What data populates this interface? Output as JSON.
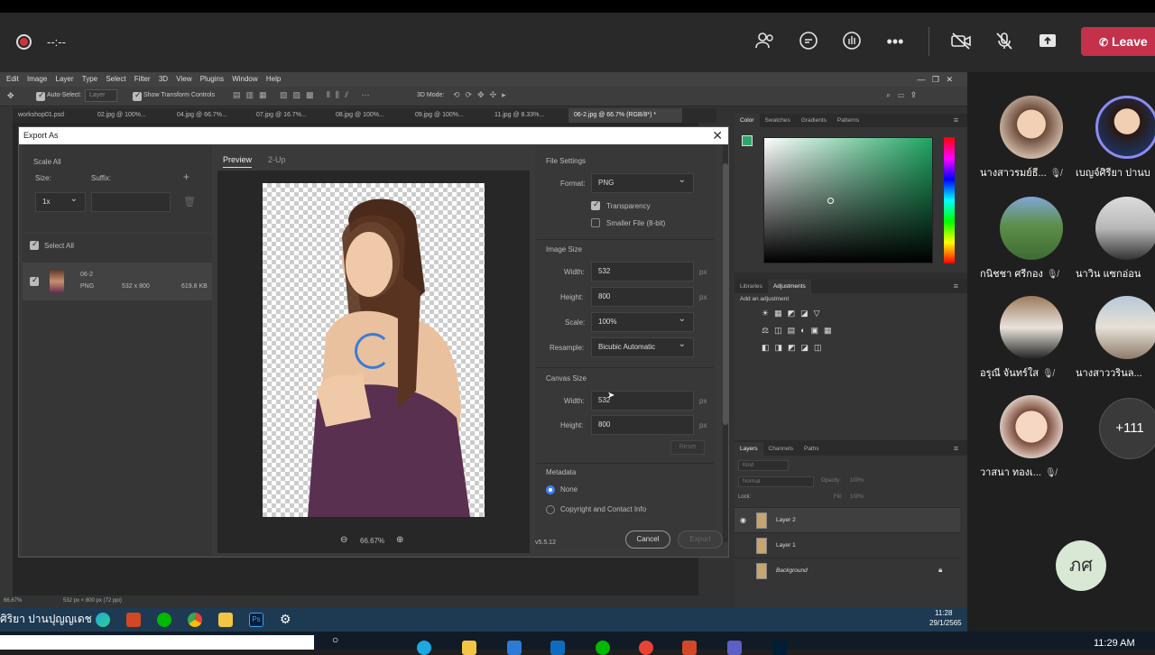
{
  "meeting": {
    "timer": "--:--",
    "leave_label": "Leave",
    "icons": [
      "record-icon",
      "people-icon",
      "chat-icon",
      "raise-hand-icon",
      "more-icon",
      "camera-off-icon",
      "mic-off-icon",
      "share-icon",
      "phone-icon"
    ]
  },
  "photoshop": {
    "menu": [
      "Edit",
      "Image",
      "Layer",
      "Type",
      "Select",
      "Filter",
      "3D",
      "View",
      "Plugins",
      "Window",
      "Help"
    ],
    "options": {
      "auto_select": "Auto-Select:",
      "layer": "Layer",
      "show_transform": "Show Transform Controls",
      "mode_3d": "3D Mode:"
    },
    "tabs": [
      "workshop01.psd",
      "02.jpg @ 100%...",
      "04.jpg @ 66.7%...",
      "07.jpg @ 16.7%...",
      "08.jpg @ 100%...",
      "09.jpg @ 100%...",
      "11.jpg @ 8.33%...",
      "06-2.jpg @ 66.7% (RGB/8*) *"
    ],
    "status": {
      "zoom": "66.67%",
      "doc": "532 px × 800 px (72 ppi)"
    },
    "color_panel": {
      "tabs": [
        "Color",
        "Swatches",
        "Gradients",
        "Patterns"
      ]
    },
    "adjust_panel": {
      "tabs": [
        "Libraries",
        "Adjustments"
      ],
      "hint": "Add an adjustment"
    },
    "layers_panel": {
      "tabs": [
        "Layers",
        "Channels",
        "Paths"
      ],
      "kind": "Kind",
      "blend": "Normal",
      "opacity_label": "Opacity:",
      "opacity": "100%",
      "lock_label": "Lock:",
      "fill_label": "Fill:",
      "fill": "100%",
      "layers": [
        "Layer 2",
        "Layer 1",
        "Background"
      ]
    }
  },
  "export_dialog": {
    "title": "Export As",
    "scale_all": "Scale All",
    "size_label": "Size:",
    "suffix_label": "Suffix:",
    "scale_value": "1x",
    "select_all": "Select All",
    "asset": {
      "name": "06-2",
      "format": "PNG",
      "dims": "532 x 800",
      "size": "619.8 KB"
    },
    "preview_tabs": [
      "Preview",
      "2-Up"
    ],
    "zoom": "66.67%",
    "file_settings": {
      "header": "File Settings",
      "format_label": "Format:",
      "format": "PNG",
      "transparency": "Transparency",
      "smaller_file": "Smaller File (8-bit)"
    },
    "image_size": {
      "header": "Image Size",
      "width_label": "Width:",
      "width": "532",
      "height_label": "Height:",
      "height": "800",
      "scale_label": "Scale:",
      "scale": "100%",
      "resample_label": "Resample:",
      "resample": "Bicubic Automatic",
      "unit": "px"
    },
    "canvas_size": {
      "header": "Canvas Size",
      "width_label": "Width:",
      "width": "532",
      "height_label": "Height:",
      "height": "800",
      "unit": "px",
      "reset": "Reset"
    },
    "metadata": {
      "header": "Metadata",
      "none": "None",
      "copyright": "Copyright and Contact Info"
    },
    "version": "v5.5.12",
    "cancel": "Cancel",
    "export": "Export"
  },
  "participants": [
    {
      "name": "นางสาวรมย์ธี..."
    },
    {
      "name": "เบญจ์ศิรียา ปานบ"
    },
    {
      "name": "กนิชชา ศรีกอง"
    },
    {
      "name": "นาวิน แซกอ่อน"
    },
    {
      "name": "อรุณี จันทร์ใส"
    },
    {
      "name": "นางสาววรินล..."
    },
    {
      "name": "วาสนา ทองเ..."
    }
  ],
  "more_count": "+111",
  "self_initials": "ภศ",
  "win_label": "ศิริยา ปานปุญญเดช",
  "clock": {
    "time": "11:28",
    "date": "29/1/2565"
  },
  "bottom_clock": "11:29 AM"
}
